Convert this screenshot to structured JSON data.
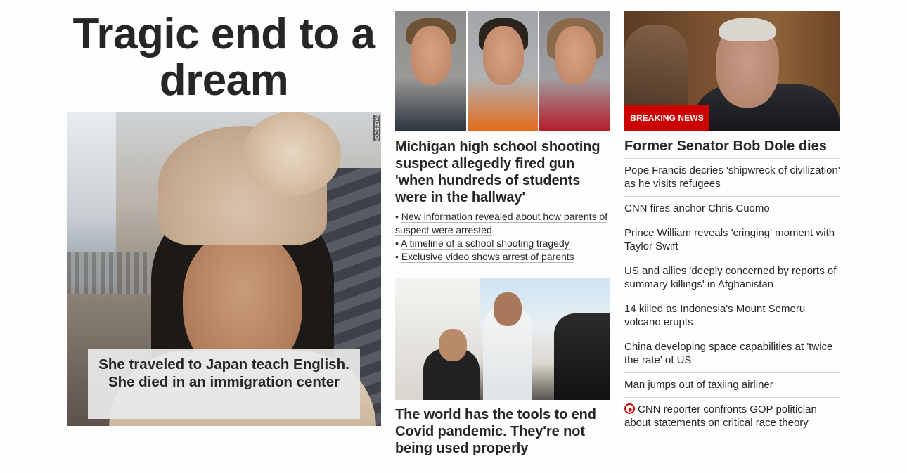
{
  "lead": {
    "title": "Tragic end to a dream",
    "caption": "She traveled to Japan teach English. She died in an immigration center",
    "photo_credit": "FACEBOOK"
  },
  "michigan": {
    "headline": "Michigan high school shooting suspect allegedly fired gun 'when hundreds of students were in the hallway'",
    "related": [
      "New information revealed about how parents of suspect were arrested",
      "A timeline of a school shooting tragedy",
      "Exclusive video shows arrest of parents"
    ]
  },
  "covid": {
    "headline": "The world has the tools to end Covid pandemic. They're not being used properly"
  },
  "dole": {
    "badge": "BREAKING NEWS",
    "headline": "Former Senator Bob Dole dies"
  },
  "headlines": [
    {
      "text": "Pope Francis decries 'shipwreck of civilization' as he visits refugees"
    },
    {
      "text": "CNN fires anchor Chris Cuomo"
    },
    {
      "text": "Prince William reveals 'cringing' moment with Taylor Swift"
    },
    {
      "text": "US and allies 'deeply concerned by reports of summary killings' in Afghanistan"
    },
    {
      "text": "14 killed as Indonesia's Mount Semeru volcano erupts"
    },
    {
      "text": "China developing space capabilities at 'twice the rate' of US"
    },
    {
      "text": "Man jumps out of taxiing airliner"
    },
    {
      "text": "CNN reporter confronts GOP politician about statements on critical race theory",
      "icon": "play-icon"
    }
  ],
  "colors": {
    "accent": "#cc0000",
    "text": "#262626",
    "divider": "#d8d8d8"
  }
}
